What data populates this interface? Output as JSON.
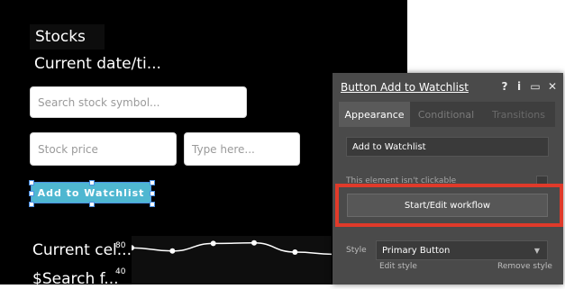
{
  "canvas": {
    "stocks_label": "Stocks",
    "date_label": "Current date/ti...",
    "search_placeholder": "Search stock symbol...",
    "price_placeholder": "Stock price",
    "type_placeholder": "Type here...",
    "watch_button_label": "Add to Watchlist",
    "current_cell_label": "Current cel...",
    "search_f_label": "$Search f..."
  },
  "chart_data": {
    "type": "line",
    "x": [
      1,
      2,
      3,
      4,
      5,
      6,
      7
    ],
    "values": [
      68,
      62,
      76,
      77,
      60,
      56,
      62
    ],
    "y_ticks": [
      "80",
      "40"
    ],
    "ylim": [
      0,
      90
    ],
    "line_color": "#ffffff",
    "grid": false
  },
  "panel": {
    "title": "Button Add to Watchlist",
    "icons": [
      "help-icon",
      "info-icon",
      "comment-icon",
      "close-icon"
    ],
    "tabs": [
      {
        "label": "Appearance",
        "active": true
      },
      {
        "label": "Conditional",
        "active": false
      },
      {
        "label": "Transitions",
        "active": false
      }
    ],
    "text_value": "Add to Watchlist",
    "not_clickable_label": "This element isn't clickable",
    "workflow_button_label": "Start/Edit workflow",
    "style_label": "Style",
    "style_value": "Primary Button",
    "edit_style_link": "Edit style",
    "remove_style_link": "Remove style",
    "highlight_color": "#e03a2a"
  }
}
